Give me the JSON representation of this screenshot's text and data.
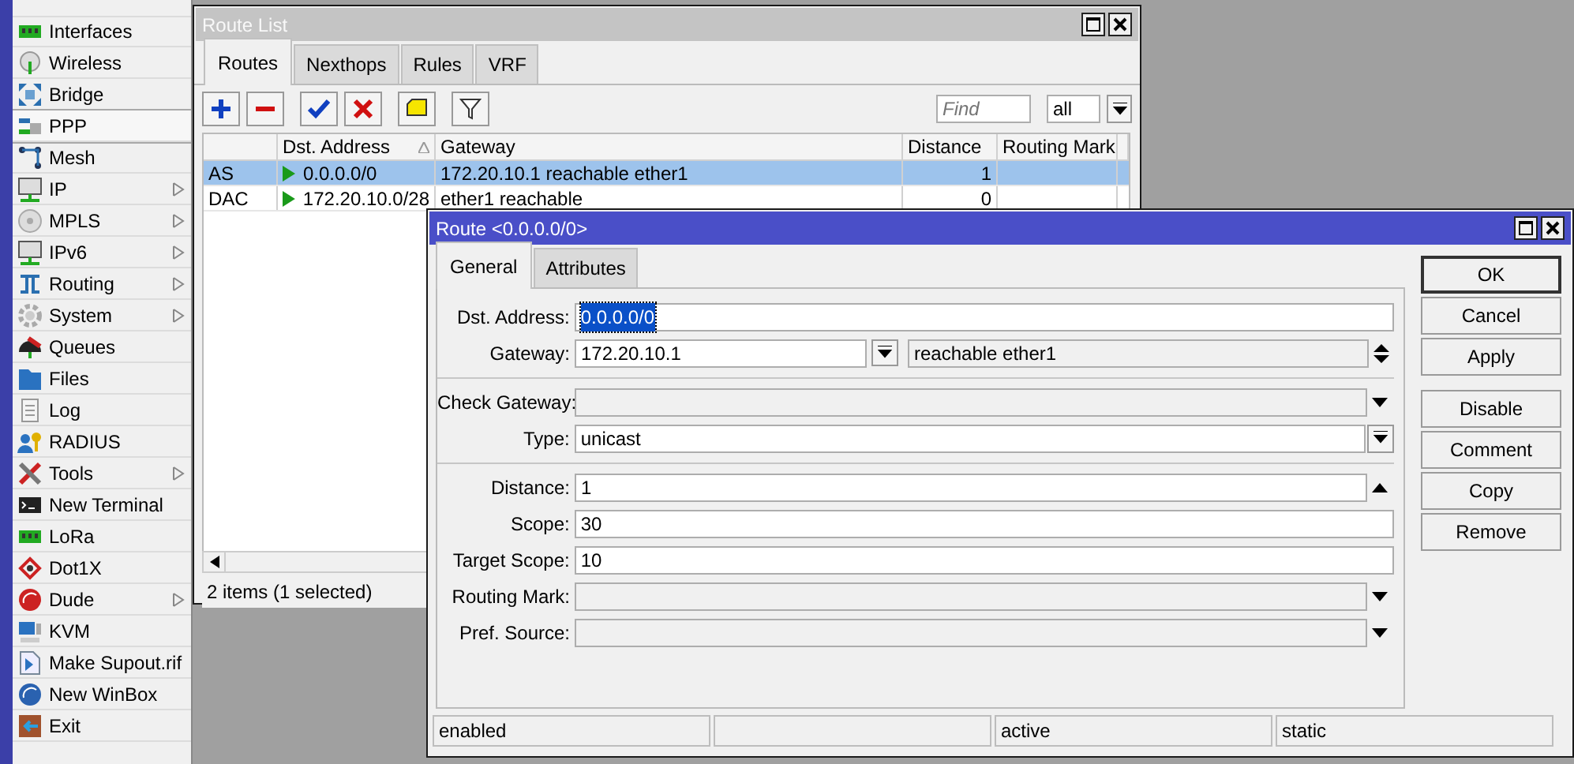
{
  "sidebar": {
    "items": [
      {
        "label": "Interfaces",
        "submenu": false,
        "selected": false
      },
      {
        "label": "Wireless",
        "submenu": false,
        "selected": false
      },
      {
        "label": "Bridge",
        "submenu": false,
        "selected": false
      },
      {
        "label": "PPP",
        "submenu": false,
        "selected": true
      },
      {
        "label": "Mesh",
        "submenu": false,
        "selected": false
      },
      {
        "label": "IP",
        "submenu": true,
        "selected": false
      },
      {
        "label": "MPLS",
        "submenu": true,
        "selected": false
      },
      {
        "label": "IPv6",
        "submenu": true,
        "selected": false
      },
      {
        "label": "Routing",
        "submenu": true,
        "selected": false
      },
      {
        "label": "System",
        "submenu": true,
        "selected": false
      },
      {
        "label": "Queues",
        "submenu": false,
        "selected": false
      },
      {
        "label": "Files",
        "submenu": false,
        "selected": false
      },
      {
        "label": "Log",
        "submenu": false,
        "selected": false
      },
      {
        "label": "RADIUS",
        "submenu": false,
        "selected": false
      },
      {
        "label": "Tools",
        "submenu": true,
        "selected": false
      },
      {
        "label": "New Terminal",
        "submenu": false,
        "selected": false
      },
      {
        "label": "LoRa",
        "submenu": false,
        "selected": false
      },
      {
        "label": "Dot1X",
        "submenu": false,
        "selected": false
      },
      {
        "label": "Dude",
        "submenu": true,
        "selected": false
      },
      {
        "label": "KVM",
        "submenu": false,
        "selected": false
      },
      {
        "label": "Make Supout.rif",
        "submenu": false,
        "selected": false
      },
      {
        "label": "New WinBox",
        "submenu": false,
        "selected": false
      },
      {
        "label": "Exit",
        "submenu": false,
        "selected": false
      }
    ]
  },
  "route_list": {
    "title": "Route List",
    "tabs": [
      {
        "label": "Routes",
        "selected": true
      },
      {
        "label": "Nexthops",
        "selected": false
      },
      {
        "label": "Rules",
        "selected": false
      },
      {
        "label": "VRF",
        "selected": false
      }
    ],
    "find": {
      "placeholder": "Find"
    },
    "filter_value": "all",
    "table": {
      "columns": [
        "",
        "Dst. Address",
        "Gateway",
        "Distance",
        "Routing Mark"
      ],
      "rows": [
        {
          "flags": "AS",
          "dst_address": "0.0.0.0/0",
          "gateway": "172.20.10.1 reachable ether1",
          "distance": "1",
          "selected": true
        },
        {
          "flags": "DAC",
          "dst_address": "172.20.10.0/28",
          "gateway": "ether1 reachable",
          "distance": "0",
          "selected": false
        }
      ]
    },
    "status": "2 items (1 selected)"
  },
  "route_dialog": {
    "title": "Route <0.0.0.0/0>",
    "tabs": [
      {
        "label": "General",
        "selected": true
      },
      {
        "label": "Attributes",
        "selected": false
      }
    ],
    "field_groups": [
      [
        {
          "label": "Dst. Address:",
          "value": "0.0.0.0/0",
          "kind": "text",
          "disabled": false,
          "text_selected": true
        },
        {
          "label": "Gateway:",
          "value": "172.20.10.1",
          "extra": "reachable ether1",
          "kind": "gateway",
          "disabled": false,
          "text_selected": false
        }
      ],
      [
        {
          "label": "Check Gateway:",
          "kind": "dropdown",
          "disabled": true
        },
        {
          "label": "Type:",
          "value": "unicast",
          "kind": "select",
          "disabled": false,
          "text_selected": false
        }
      ],
      [
        {
          "label": "Distance:",
          "value": "1",
          "kind": "up",
          "disabled": false,
          "text_selected": false
        },
        {
          "label": "Scope:",
          "value": "30",
          "kind": "text",
          "disabled": false,
          "text_selected": false
        },
        {
          "label": "Target Scope:",
          "value": "10",
          "kind": "text",
          "disabled": false,
          "text_selected": false
        },
        {
          "label": "Routing Mark:",
          "kind": "dropdown",
          "disabled": true
        },
        {
          "label": "Pref. Source:",
          "kind": "dropdown",
          "disabled": true
        }
      ]
    ],
    "buttons": [
      {
        "label": "OK",
        "default": true
      },
      {
        "label": "Cancel",
        "default": false
      },
      {
        "label": "Apply",
        "default": false
      },
      {
        "label": "Disable",
        "default": false
      },
      {
        "label": "Comment",
        "default": false
      },
      {
        "label": "Copy",
        "default": false
      },
      {
        "label": "Remove",
        "default": false
      }
    ],
    "status": [
      {
        "text": "enabled",
        "gap_before": false
      },
      {
        "text": "active",
        "gap_before": true
      },
      {
        "text": "static",
        "gap_before": false
      }
    ]
  }
}
